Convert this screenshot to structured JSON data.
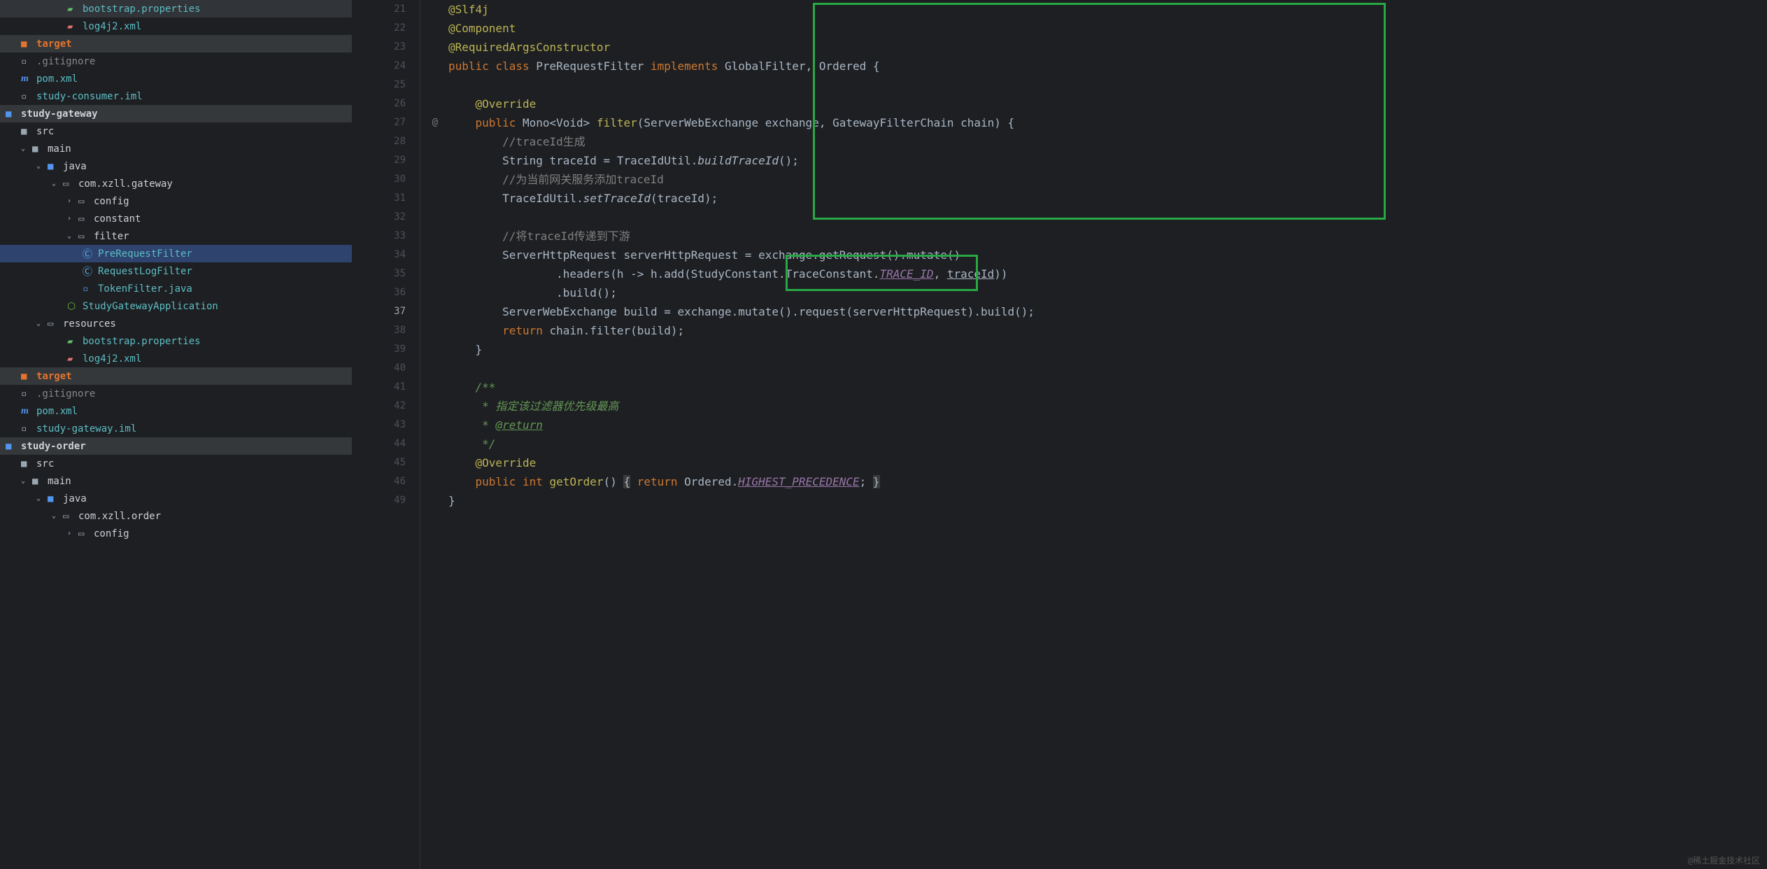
{
  "tree": {
    "bootstrap_props": "bootstrap.properties",
    "log4j2_xml": "log4j2.xml",
    "target": "target",
    "gitignore": ".gitignore",
    "pom_xml": "pom.xml",
    "study_consumer_iml": "study-consumer.iml",
    "study_gateway": "study-gateway",
    "src": "src",
    "main": "main",
    "java": "java",
    "pkg_gateway": "com.xzll.gateway",
    "config": "config",
    "constant": "constant",
    "filter": "filter",
    "pre_request_filter": "PreRequestFilter",
    "request_log_filter": "RequestLogFilter",
    "token_filter": "TokenFilter.java",
    "study_gw_app": "StudyGatewayApplication",
    "resources": "resources",
    "study_gateway_iml": "study-gateway.iml",
    "study_order": "study-order",
    "pkg_order": "com.xzll.order"
  },
  "code": {
    "l21": "@Slf4j",
    "l22": "@Component",
    "l23": "@RequiredArgsConstructor",
    "l24_kw1": "public class ",
    "l24_name": "PreRequestFilter ",
    "l24_kw2": "implements ",
    "l24_impl": "GlobalFilter, Ordered {",
    "l26": "@Override",
    "l27_kw": "public ",
    "l27_ret": "Mono<Void> ",
    "l27_name": "filter",
    "l27_sig": "(ServerWebExchange exchange, GatewayFilterChain chain) {",
    "l28": "//traceId生成",
    "l29_a": "String traceId = TraceIdUtil.",
    "l29_b": "buildTraceId",
    "l29_c": "();",
    "l30": "//为当前网关服务添加traceId",
    "l31_a": "TraceIdUtil.",
    "l31_b": "setTraceId",
    "l31_c": "(traceId);",
    "l33": "//将traceId传递到下游",
    "l34": "ServerHttpRequest serverHttpRequest = exchange.getRequest().mutate()",
    "l35_a": "        .headers(h -> h.add(StudyConstant.TraceConstant.",
    "l35_b": "TRACE_ID",
    "l35_c": ", ",
    "l35_d": "traceId",
    "l35_e": "))",
    "l36": "        .build();",
    "l37": "ServerWebExchange build = exchange.mutate().request(serverHttpRequest).build();",
    "l38_a": "return ",
    "l38_b": "chain.filter(build);",
    "l39": "}",
    "l41": "/**",
    "l42": " * 指定该过滤器优先级最高",
    "l43_a": " * ",
    "l43_b": "@return",
    "l44": " */",
    "l45": "@Override",
    "l46_a": "public int ",
    "l46_b": "getOrder",
    "l46_c": "() ",
    "l46_d": "{",
    "l46_e": " return ",
    "l46_f": "Ordered.",
    "l46_g": "HIGHEST_PRECEDENCE",
    "l46_h": "; ",
    "l46_i": "}",
    "l49": "}"
  },
  "gutter": {
    "at": "@"
  },
  "watermark": "@稀土掘金技术社区"
}
